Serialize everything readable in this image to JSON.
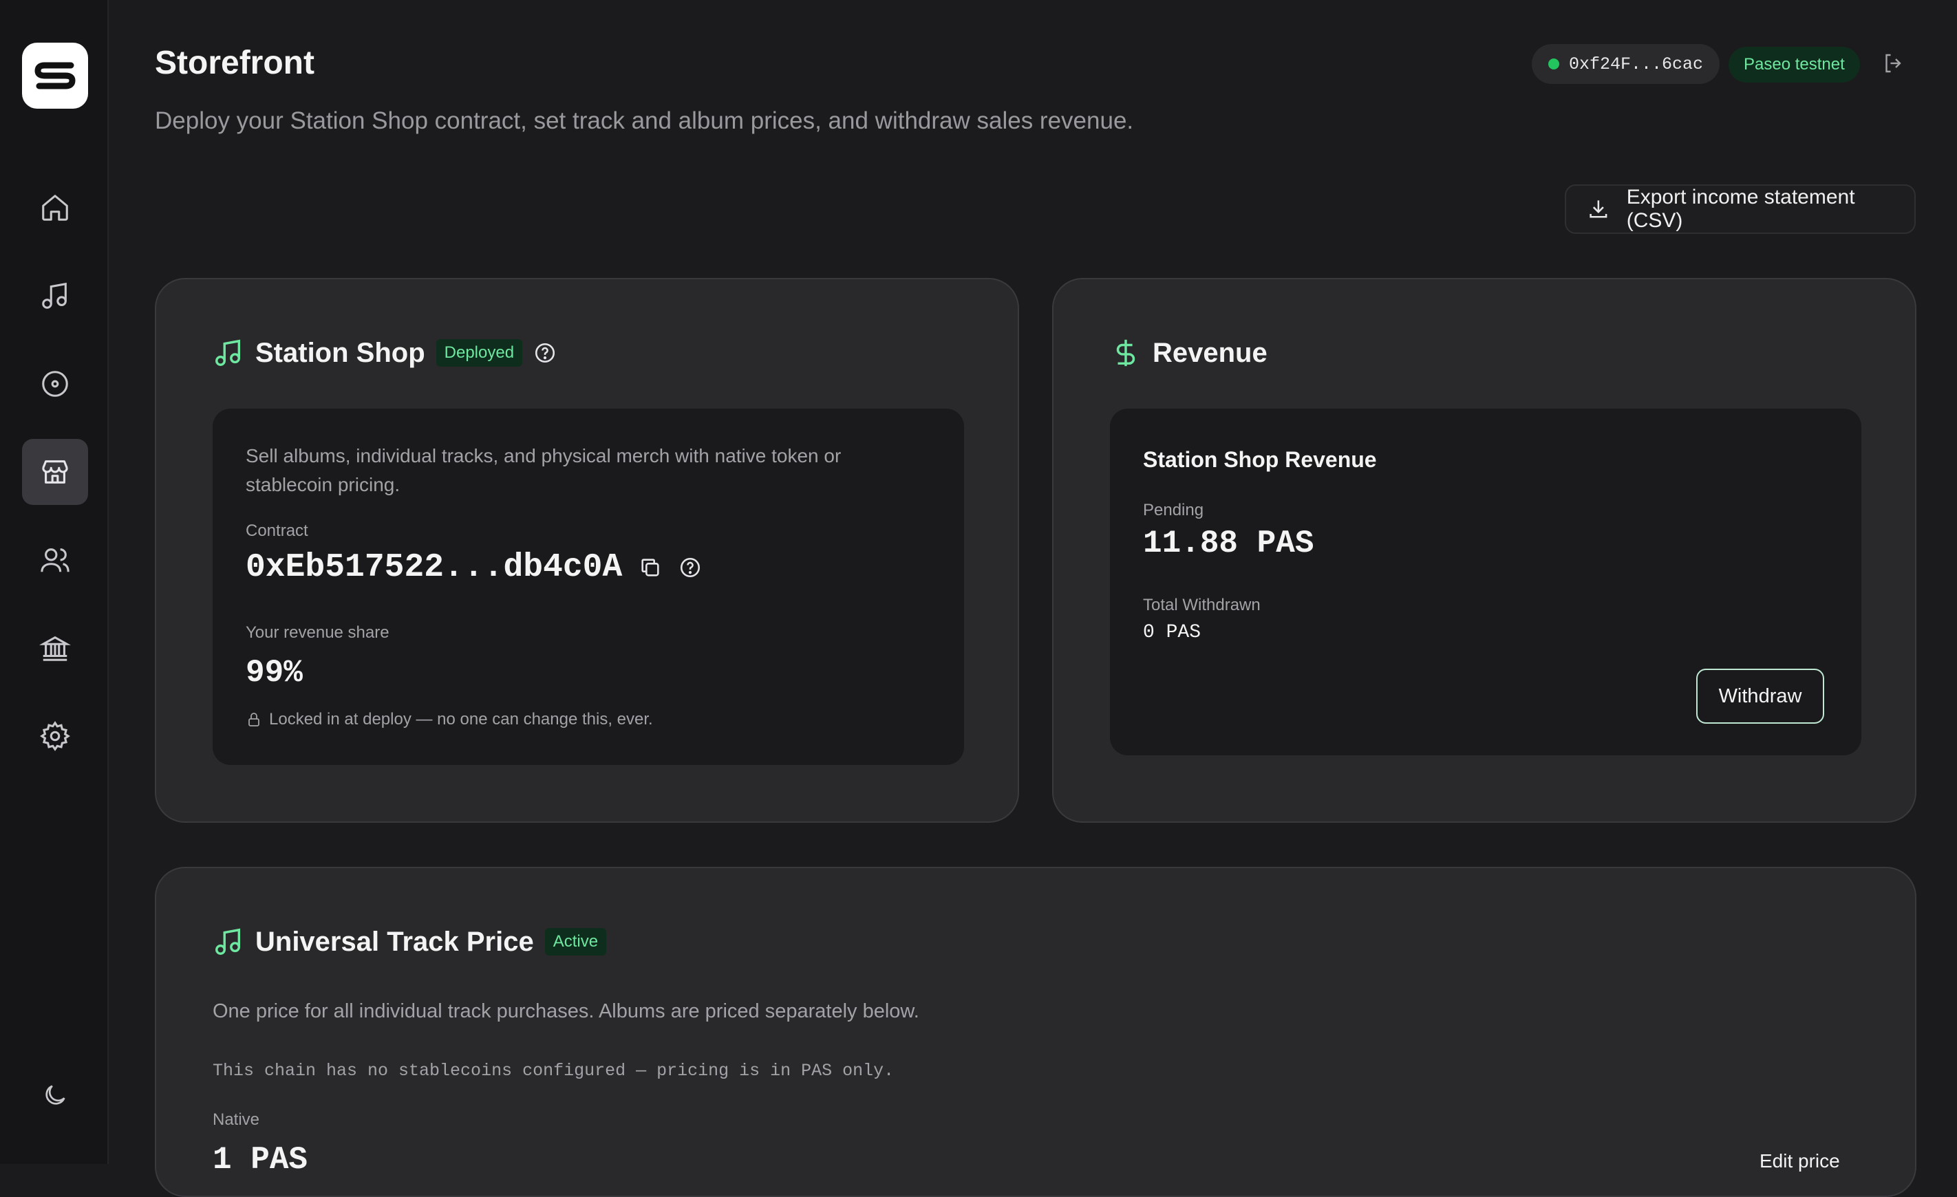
{
  "header": {
    "title": "Storefront",
    "subtitle": "Deploy your Station Shop contract, set track and album prices, and withdraw sales revenue.",
    "wallet_address": "0xf24F...6cac",
    "network": "Paseo testnet",
    "export_label": "Export income statement (CSV)"
  },
  "sidebar": {
    "items": [
      {
        "name": "home",
        "icon": "home-icon"
      },
      {
        "name": "music",
        "icon": "music-note-icon"
      },
      {
        "name": "disc",
        "icon": "disc-icon"
      },
      {
        "name": "storefront",
        "icon": "store-icon",
        "active": true
      },
      {
        "name": "users",
        "icon": "users-icon"
      },
      {
        "name": "bank",
        "icon": "bank-icon"
      },
      {
        "name": "settings",
        "icon": "gear-icon"
      }
    ],
    "theme_toggle_icon": "moon-icon"
  },
  "station_shop": {
    "title": "Station Shop",
    "status": "Deployed",
    "description": "Sell albums, individual tracks, and physical merch with native token or stablecoin pricing.",
    "contract_label": "Contract",
    "contract_address": "0xEb517522...db4c0A",
    "revenue_share_label": "Your revenue share",
    "revenue_share": "99%",
    "lock_note": "Locked in at deploy — no one can change this, ever."
  },
  "revenue": {
    "title": "Revenue",
    "panel_title": "Station Shop Revenue",
    "pending_label": "Pending",
    "pending_value": "11.88 PAS",
    "withdrawn_label": "Total Withdrawn",
    "withdrawn_value": "0 PAS",
    "withdraw_label": "Withdraw"
  },
  "track_price": {
    "title": "Universal Track Price",
    "status": "Active",
    "description": "One price for all individual track purchases. Albums are priced separately below.",
    "chain_note": "This chain has no stablecoins configured — pricing is in PAS only.",
    "native_label": "Native",
    "native_value": "1 PAS",
    "edit_label": "Edit price"
  },
  "colors": {
    "accent_green": "#6ee7a0",
    "status_green": "#22c55e",
    "background": "#1b1b1d",
    "card": "#29292c"
  }
}
